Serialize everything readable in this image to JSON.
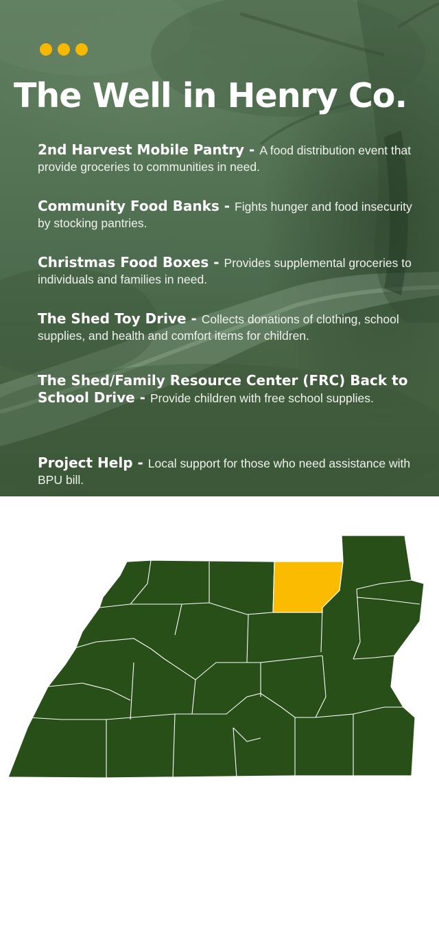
{
  "header": {
    "title": "The Well in Henry Co."
  },
  "colors": {
    "accent": "#f7b900",
    "map_fill": "#274f17",
    "highlight_fill": "#fbbb00"
  },
  "programs": [
    {
      "name": "2nd Harvest Mobile Pantry",
      "separator": " - ",
      "description": "A food distribution event that provide groceries to communities in need."
    },
    {
      "name": "Community Food Banks",
      "separator": " - ",
      "description": "Fights hunger and food insecurity by stocking pantries."
    },
    {
      "name": "Christmas Food Boxes",
      "separator": " - ",
      "description": "Provides supplemental groceries to individuals and families in need."
    },
    {
      "name": "The Shed Toy Drive",
      "separator": " - ",
      "description": "Collects donations of clothing, school supplies, and health and comfort items for children."
    },
    {
      "name": "The Shed/Family Resource Center (FRC) Back to School Drive",
      "separator": " - ",
      "description": "Provide children with free school supplies."
    },
    {
      "name": "Project Help",
      "separator": " - ",
      "description": "Local support for those who need assistance with BPU bill."
    }
  ],
  "map": {
    "highlighted_county": "Henry"
  }
}
